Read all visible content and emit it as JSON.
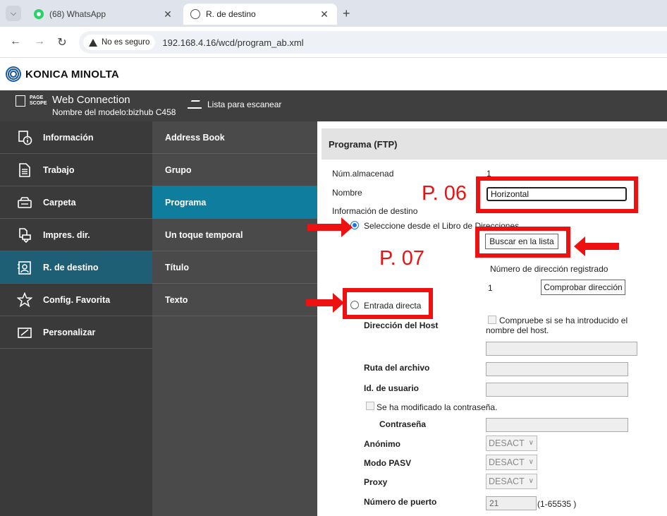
{
  "browser": {
    "tabs": [
      {
        "title": "(68) WhatsApp"
      },
      {
        "title": "R. de destino"
      }
    ],
    "security_label": "No es seguro",
    "url": "192.168.4.16/wcd/program_ab.xml"
  },
  "brand": {
    "name": "KONICA MINOLTA"
  },
  "header": {
    "logo_line1": "PAGE",
    "logo_line2": "SCOPE",
    "title": "Web Connection",
    "model": "Nombre del modelo:bizhub C458",
    "scan_list": "Lista para escanear"
  },
  "leftnav": {
    "items": [
      {
        "label": "Información",
        "icon": "info-icon"
      },
      {
        "label": "Trabajo",
        "icon": "document-icon"
      },
      {
        "label": "Carpeta",
        "icon": "folder-icon"
      },
      {
        "label": "Impres. dir.",
        "icon": "print-icon"
      },
      {
        "label": "R. de destino",
        "icon": "address-book-icon"
      },
      {
        "label": "Config. Favorita",
        "icon": "star-icon"
      },
      {
        "label": "Personalizar",
        "icon": "customize-icon"
      }
    ],
    "active": "R. de destino"
  },
  "subnav": {
    "items": [
      {
        "label": "Address Book"
      },
      {
        "label": "Grupo"
      },
      {
        "label": "Programa"
      },
      {
        "label": "Un toque temporal"
      },
      {
        "label": "Título"
      },
      {
        "label": "Texto"
      }
    ],
    "active": "Programa"
  },
  "form": {
    "heading": "Programa (FTP)",
    "num_almacenad_label": "Núm.almacenad",
    "num_almacenad_value": "1",
    "nombre_label": "Nombre",
    "nombre_value": "Horizontal",
    "info_destino_label": "Información de destino",
    "radio_libro_label": "Seleccione desde el Libro de Direcciones",
    "buscar_button": "Buscar en la lista",
    "num_dir_label": "Número de dirección registrado",
    "num_dir_value": "1",
    "comprobar_button": "Comprobar dirección",
    "radio_directa_label": "Entrada directa",
    "host_label": "Dirección del Host",
    "host_check_label": "Compruebe si se ha introducido el nombre del host.",
    "ruta_label": "Ruta del archivo",
    "usuario_label": "Id. de usuario",
    "pwd_changed_label": "Se ha modificado la contraseña.",
    "pwd_label": "Contraseña",
    "anonimo_label": "Anónimo",
    "anonimo_value": "DESACT",
    "pasv_label": "Modo PASV",
    "pasv_value": "DESACT",
    "proxy_label": "Proxy",
    "proxy_value": "DESACT",
    "puerto_label": "Número de puerto",
    "puerto_value": "21",
    "puerto_range": "(1-65535 )"
  },
  "annotations": {
    "p06": "P. 06",
    "p07": "P. 07",
    "color": "#ee1111"
  }
}
